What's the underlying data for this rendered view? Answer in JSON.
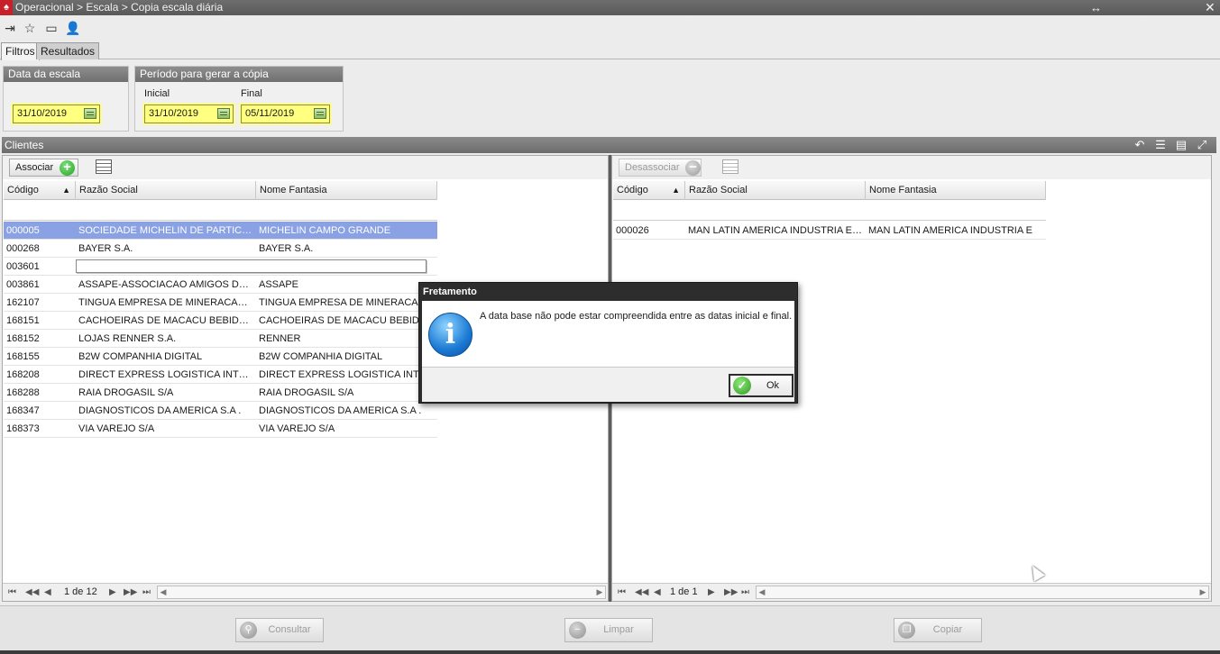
{
  "window": {
    "app_icon": "app-logo",
    "title": "Operacional > Escala > Copia escala diária",
    "resize_glyph": "↔",
    "close_glyph": "✕"
  },
  "toolbar": {
    "icons": [
      "exit-icon",
      "favorite-icon",
      "screen-icon",
      "user-icon"
    ]
  },
  "tabs": [
    {
      "label": "Filtros",
      "active": true
    },
    {
      "label": "Resultados",
      "active": false
    }
  ],
  "filters": {
    "data_escala": {
      "title": "Data da escala",
      "value": "31/10/2019"
    },
    "periodo": {
      "title": "Período para gerar a cópia",
      "inicial_label": "Inicial",
      "inicial_value": "31/10/2019",
      "final_label": "Final",
      "final_value": "05/11/2019"
    }
  },
  "clientes": {
    "title": "Clientes",
    "header_icons": [
      "undo-icon",
      "grid-icon",
      "layout-icon",
      "fullscreen-icon"
    ]
  },
  "left_grid": {
    "button_label": "Associar",
    "columns": [
      "Código",
      "Razão Social",
      "Nome Fantasia"
    ],
    "sort_indicator": "▲",
    "rows": [
      {
        "codigo": "000005",
        "razao": "SOCIEDADE MICHELIN DE PARTICIPA...",
        "fantasia": "MICHELIN CAMPO GRANDE",
        "selected": true
      },
      {
        "codigo": "000268",
        "razao": "BAYER S.A.",
        "fantasia": "BAYER S.A."
      },
      {
        "codigo": "003601",
        "razao": "",
        "fantasia": "",
        "editing": true
      },
      {
        "codigo": "003861",
        "razao": "ASSAPE-ASSOCIACAO AMIGOS DA P...",
        "fantasia": "ASSAPE"
      },
      {
        "codigo": "162107",
        "razao": "TINGUA EMPRESA DE MINERACAO E ...",
        "fantasia": "TINGUA EMPRESA DE MINERACAO"
      },
      {
        "codigo": "168151",
        "razao": "CACHOEIRAS DE MACACU BEBIDAS L...",
        "fantasia": "CACHOEIRAS DE MACACU BEBIDAS L"
      },
      {
        "codigo": "168152",
        "razao": "LOJAS RENNER S.A.",
        "fantasia": "RENNER"
      },
      {
        "codigo": "168155",
        "razao": "B2W COMPANHIA DIGITAL",
        "fantasia": "B2W COMPANHIA DIGITAL"
      },
      {
        "codigo": "168208",
        "razao": "DIRECT EXPRESS LOGISTICA INTEGR...",
        "fantasia": "DIRECT EXPRESS LOGISTICA INTEG"
      },
      {
        "codigo": "168288",
        "razao": "RAIA DROGASIL S/A",
        "fantasia": "RAIA DROGASIL S/A"
      },
      {
        "codigo": "168347",
        "razao": "DIAGNOSTICOS DA AMERICA S.A .",
        "fantasia": "DIAGNOSTICOS DA AMERICA S.A ."
      },
      {
        "codigo": "168373",
        "razao": "VIA VAREJO S/A",
        "fantasia": "VIA VAREJO S/A"
      }
    ],
    "pager": "1 de 12"
  },
  "right_grid": {
    "button_label": "Desassociar",
    "columns": [
      "Código",
      "Razão Social",
      "Nome Fantasia"
    ],
    "sort_indicator": "▲",
    "rows": [
      {
        "codigo": "000026",
        "razao": "MAN LATIN AMERICA INDUSTRIA E C...",
        "fantasia": "MAN LATIN AMERICA INDUSTRIA E"
      }
    ],
    "pager": "1 de 1"
  },
  "pager_glyphs": {
    "first": "⏮",
    "prev_page": "◀◀",
    "prev": "◀",
    "next": "▶",
    "next_page": "▶▶",
    "last": "⏭"
  },
  "bottom_buttons": {
    "consultar": "Consultar",
    "limpar": "Limpar",
    "copiar": "Copiar"
  },
  "dialog": {
    "title": "Fretamento",
    "icon": "info-icon",
    "icon_glyph": "i",
    "message": "A data base não pode estar compreendida entre as datas inicial e final.",
    "ok_label": "Ok"
  }
}
